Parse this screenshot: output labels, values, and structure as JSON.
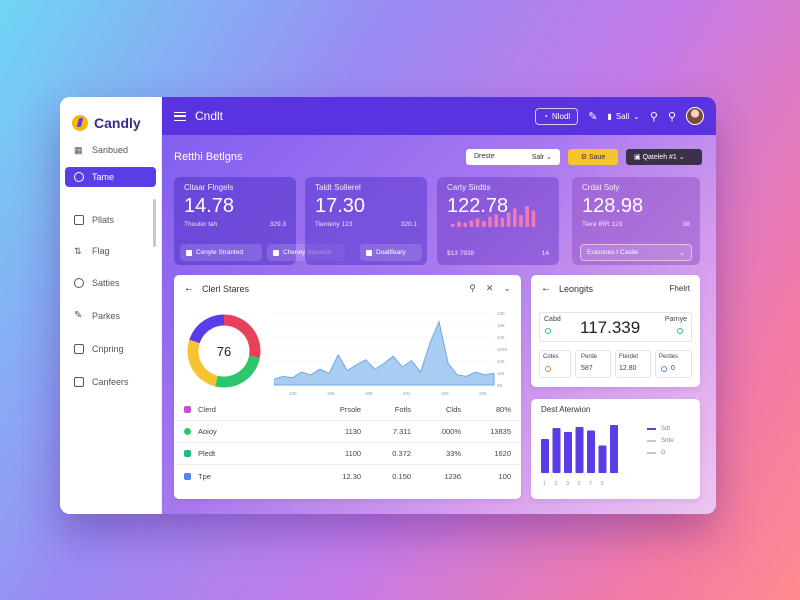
{
  "brand": {
    "name": "Candly"
  },
  "sidebar": {
    "items": [
      {
        "label": "Sanbued",
        "icon": "dashboard-icon"
      },
      {
        "label": "Tame",
        "icon": "search-icon"
      },
      {
        "label": "Pllats",
        "icon": "grid-icon"
      },
      {
        "label": "Flag",
        "icon": "sort-icon"
      },
      {
        "label": "Satties",
        "icon": "check-icon"
      },
      {
        "label": "Parkes",
        "icon": "pen-icon"
      },
      {
        "label": "Cnpring",
        "icon": "calendar-icon"
      },
      {
        "label": "Canfeers",
        "icon": "lock-icon"
      }
    ]
  },
  "topbar": {
    "title": "Cndlt",
    "mode_label": "Nlodl",
    "user_menu": "Sall"
  },
  "header": {
    "title": "Retthi Betlgns",
    "date_label": "Dreste",
    "date_value": "Salr",
    "save_label": "Saue",
    "action_label": "Qateleh #1"
  },
  "metrics": [
    {
      "label": "Cltaar Flngels",
      "value": "14.78",
      "sub_left": "Thouter tah",
      "sub_right": "329.3",
      "pills": [
        "Cenyte Stranted",
        "Cheney Socated"
      ]
    },
    {
      "label": "Taldt Sollerel",
      "value": "17.30",
      "sub_left": "Tienteny 123",
      "sub_right": "320.1",
      "pills": [
        "Doaltfeary"
      ]
    },
    {
      "label": "Carty Sirdtis",
      "value": "122.78",
      "sub_left": "$13 7938",
      "sub_right": "14",
      "pills": []
    },
    {
      "label": "Crdat Soly",
      "value": "128.98",
      "sub_left": "Tiere IRR 123",
      "sub_right": "38",
      "pills": [
        "Erasones t Caslie"
      ]
    }
  ],
  "client_panel": {
    "title": "Clerl Stares",
    "donut_value": "76",
    "y_ticks": [
      "130",
      "188",
      "126",
      "1028",
      "126",
      "116",
      "56"
    ],
    "x_ticks": [
      "120",
      "105",
      "109",
      "201",
      "150",
      "225"
    ],
    "table": {
      "headers": [
        "Clerd",
        "Prsole",
        "Fotls",
        "Clds",
        "80%"
      ],
      "rows": [
        [
          "Aoioy",
          "1130",
          "7.311",
          "000%",
          "13835"
        ],
        [
          "Pledt",
          "1100",
          "0.372",
          "33%",
          "1620"
        ],
        [
          "Tpe",
          "12.30",
          "0.150",
          "1236",
          "100"
        ]
      ]
    }
  },
  "leongits_panel": {
    "title": "Leongits",
    "right_label": "Fhelrt",
    "stat_label": "Cabd",
    "stat_value": "117.339",
    "stat_right": "Parnye",
    "mini": [
      {
        "label": "Cotes",
        "value": ""
      },
      {
        "label": "Perde",
        "value": "587"
      },
      {
        "label": "Fterdet",
        "value": "12.80"
      },
      {
        "label": "Perdes",
        "value": "0"
      }
    ]
  },
  "bar_panel": {
    "title": "Dest Aterwion",
    "legend": [
      "Sdt",
      "Srde",
      "G"
    ]
  },
  "chart_data": [
    {
      "type": "pie",
      "values": [
        28,
        26,
        26,
        20
      ],
      "colors": [
        "#e8405a",
        "#2ec66b",
        "#f6c431",
        "#5b3de8"
      ],
      "center_label": "76"
    },
    {
      "type": "area",
      "x": [
        0,
        1,
        2,
        3,
        4,
        5,
        6,
        7,
        8,
        9,
        10,
        11,
        12,
        13,
        14,
        15,
        16,
        17,
        18,
        19,
        20,
        21,
        22,
        23,
        24
      ],
      "values": [
        8,
        12,
        10,
        18,
        14,
        22,
        16,
        42,
        20,
        28,
        35,
        22,
        30,
        40,
        25,
        34,
        18,
        58,
        88,
        30,
        14,
        12,
        18,
        14,
        16
      ],
      "ylim": [
        0,
        100
      ],
      "color": "#6fa8e6"
    },
    {
      "type": "bar",
      "categories": [
        "1",
        "2",
        "3",
        "5",
        "7",
        "3"
      ],
      "values": [
        68,
        90,
        82,
        92,
        85,
        55,
        96
      ],
      "color": "#5b3de8"
    },
    {
      "type": "bar",
      "values": [
        10,
        18,
        14,
        22,
        28,
        20,
        34,
        42,
        30,
        48,
        62,
        40,
        70,
        55
      ],
      "color": "#f07ab8"
    }
  ]
}
